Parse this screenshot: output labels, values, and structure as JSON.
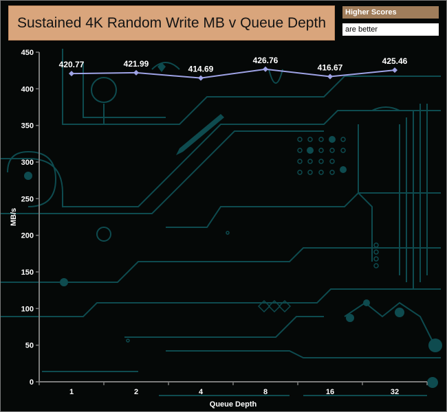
{
  "title": "Sustained 4K Random Write MB v Queue Depth",
  "note": {
    "line1": "Higher Scores",
    "line2": "are better"
  },
  "colors": {
    "line": "#9fa3e6",
    "title_bg": "#d9a57c",
    "note_bg": "#a07d5b",
    "circuit": "#0e4b4f"
  },
  "chart_data": {
    "type": "line",
    "title": "Sustained 4K Random Write MB v Queue Depth",
    "xlabel": "Queue Depth",
    "ylabel": "MB/s",
    "categories": [
      "1",
      "2",
      "4",
      "8",
      "16",
      "32"
    ],
    "series": [
      {
        "values": [
          420.77,
          421.99,
          414.69,
          426.76,
          416.67,
          425.46
        ]
      }
    ],
    "ylim": [
      0,
      450
    ],
    "yticks": [
      0,
      50,
      100,
      150,
      200,
      250,
      300,
      350,
      400,
      450
    ],
    "data_labels": [
      "420.77",
      "421.99",
      "414.69",
      "426.76",
      "416.67",
      "425.46"
    ],
    "grid": false,
    "legend": "none"
  }
}
